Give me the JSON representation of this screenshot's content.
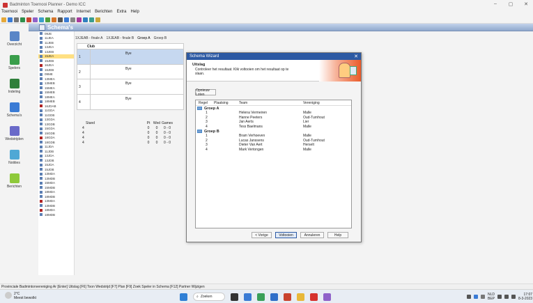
{
  "window": {
    "title": "Badminton Toernooi Planner - Demo ICC"
  },
  "menu": [
    "Toernooi",
    "Speler",
    "Schema",
    "Rapport",
    "Internet",
    "Berichten",
    "Extra",
    "Help"
  ],
  "nav": [
    {
      "label": "Overzicht",
      "icon": "overview-icon"
    },
    {
      "label": "Spelers",
      "icon": "players-icon"
    },
    {
      "label": "Indeling",
      "icon": "layout-icon"
    },
    {
      "label": "Schema's",
      "icon": "schemes-icon"
    },
    {
      "label": "Wedstrijden",
      "icon": "matches-icon"
    },
    {
      "label": "Notities",
      "icon": "notes-icon"
    },
    {
      "label": "Berichten",
      "icon": "messages-icon"
    }
  ],
  "section_title": "Schema's",
  "tree": [
    "09JE",
    "11JEA",
    "11JEB",
    "13JEA",
    "13JEB",
    "15JEA",
    "15JEB",
    "16JEA",
    "16JEB",
    "09ME",
    "13MEA",
    "13MEB",
    "15MEA",
    "15MEB",
    "18MEA",
    "18MEB",
    "16JDAB",
    "11GDA",
    "11GDB",
    "13GDA",
    "13GDB",
    "15GDA",
    "15GDB",
    "18GDA",
    "18GDB",
    "11JDA",
    "11JDB",
    "13JDA",
    "13JDB",
    "15JDA",
    "15JDB",
    "13MDA",
    "13MDB",
    "15MDA",
    "15MDB",
    "18MDA",
    "18MDB",
    "13MDA",
    "13MDB",
    "18MDA",
    "18MDB"
  ],
  "tabs": [
    "1XJEAB - finale A",
    "1XJEAB - finale B",
    "Groep A",
    "Groep B"
  ],
  "club": {
    "header": "Club",
    "rows": [
      {
        "n": "1",
        "v": "Bye"
      },
      {
        "n": "2",
        "v": "Bye"
      },
      {
        "n": "3",
        "v": "Bye"
      },
      {
        "n": "4",
        "v": "Bye"
      }
    ]
  },
  "stand": {
    "headers": [
      "Stand",
      "Pt",
      "Wed",
      "Games"
    ],
    "rows": [
      [
        "4",
        "0",
        "0",
        "0 - 0"
      ],
      [
        "4",
        "0",
        "0",
        "0 - 0"
      ],
      [
        "4",
        "0",
        "0",
        "0 - 0"
      ],
      [
        "4",
        "0",
        "0",
        "0 - 0"
      ]
    ]
  },
  "wizard": {
    "title": "Schema Wizard",
    "close": "✕",
    "heading": "Uitslag",
    "description": "Controleer het resultaat. Klik voltooien om het resultaat op te slaan.",
    "reload": "Opnieuw Loten",
    "columns": [
      "Regel",
      "Plaatsing",
      "Team",
      "Vereniging"
    ],
    "groups": [
      {
        "name": "Groep A",
        "rows": [
          {
            "r": "1",
            "team": "Helena Vermeiren",
            "club": "Malle"
          },
          {
            "r": "2",
            "team": "Hanne Peeters",
            "club": "Oud-Turnhout"
          },
          {
            "r": "3",
            "team": "Jan Aerts",
            "club": "Lier"
          },
          {
            "r": "4",
            "team": "Tess Baelmans",
            "club": "Malle"
          }
        ]
      },
      {
        "name": "Groep B",
        "rows": [
          {
            "r": "1",
            "team": "Bram Verhoeven",
            "club": "Malle"
          },
          {
            "r": "2",
            "team": "Lucas Janssens",
            "club": "Oud-Turnhout"
          },
          {
            "r": "3",
            "team": "Dieter Van Aert",
            "club": "Herselt"
          },
          {
            "r": "4",
            "team": "Mark Vertongen",
            "club": "Malle"
          }
        ]
      }
    ],
    "buttons": {
      "back": "< Vorige",
      "finish": "Voltooien",
      "cancel": "Annuleren",
      "help": "Help"
    }
  },
  "status": "Provinciale Badmintonvereniging Ar   [Enter] Uitslag [F6] Toon Wedstrijd [F7] Plan [F9] Zoek Speler in Schema [F12] Partner Wijzigen",
  "taskbar": {
    "temp": "2°C",
    "weather": "Meest bewolkt",
    "search": "Zoeken",
    "lang": "NLD",
    "lang2": "BEP",
    "time": "17:07",
    "date": "8-3-2023"
  },
  "colors": {
    "accent": "#2c59a3",
    "header": "#8fa8cc",
    "selected": "#c6d8f0",
    "tree_selected": "#ffe082"
  }
}
